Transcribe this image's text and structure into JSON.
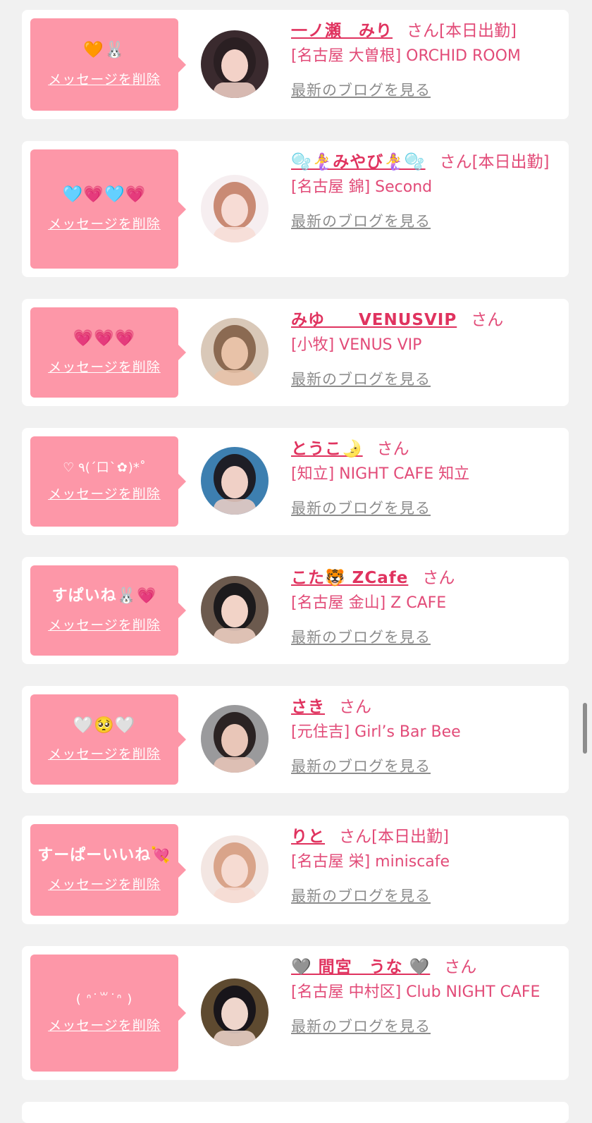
{
  "items": [
    {
      "bubble": "🧡🐰",
      "delete_label": "メッセージを削除",
      "name": "一ノ瀬　みり",
      "san": "さん",
      "status": "[本日出勤]",
      "shop": "[名古屋 大曽根] ORCHID ROOM",
      "blog": "最新のブログを見る",
      "avatar": {
        "bg": "#3a2a2e",
        "skin": "#f3d2c8",
        "hair": "#2a1f22"
      }
    },
    {
      "bubble": "🩵💗🩵💗",
      "delete_label": "メッセージを削除",
      "name": "🫧🧜‍♀️みやび🧜‍♀️🫧",
      "san": "さん",
      "status": "[本日出勤]",
      "shop": "[名古屋 錦] Second",
      "blog": "最新のブログを見る",
      "avatar": {
        "bg": "#f6eef0",
        "skin": "#f7dcd5",
        "hair": "#c98a74"
      }
    },
    {
      "bubble": "💗💗💗",
      "delete_label": "メッセージを削除",
      "name": "みゆ　　VENUSVIP",
      "san": "さん",
      "status": "",
      "shop": "[小牧] VENUS VIP",
      "blog": "最新のブログを見る",
      "avatar": {
        "bg": "#d9c8b8",
        "skin": "#e8c2a8",
        "hair": "#8b6a52"
      }
    },
    {
      "bubble": "♡ ٩(ˊ口ˋ✿)*˚",
      "delete_label": "メッセージを削除",
      "name": "とうこ🌛",
      "san": "さん",
      "status": "",
      "shop": "[知立] NIGHT CAFE 知立",
      "blog": "最新のブログを見る",
      "avatar": {
        "bg": "#3d7fb0",
        "skin": "#f0d0c6",
        "hair": "#1e1e26"
      }
    },
    {
      "bubble": "すぱいね🐰💗",
      "delete_label": "メッセージを削除",
      "name": "こた🐯 ZCafe",
      "san": "さん",
      "status": "",
      "shop": "[名古屋 金山] Z CAFE",
      "blog": "最新のブログを見る",
      "avatar": {
        "bg": "#6c5a4e",
        "skin": "#f2d3c7",
        "hair": "#1c1a1c"
      }
    },
    {
      "bubble": "🤍🥺🤍",
      "delete_label": "メッセージを削除",
      "name": "さき",
      "san": "さん",
      "status": "",
      "shop": "[元住吉] Girl’s Bar Bee",
      "blog": "最新のブログを見る",
      "avatar": {
        "bg": "#9a9a9c",
        "skin": "#e9c6b8",
        "hair": "#2b2323"
      }
    },
    {
      "bubble": "すーぱーいいね💘",
      "delete_label": "メッセージを削除",
      "name": "りと",
      "san": "さん",
      "status": "[本日出勤]",
      "shop": "[名古屋 栄] miniscafe",
      "blog": "最新のブログを見る",
      "avatar": {
        "bg": "#f3e6e2",
        "skin": "#f6dbd2",
        "hair": "#d9a48a"
      }
    },
    {
      "bubble": "( ᐢ˙꒳˙ᐢ )",
      "delete_label": "メッセージを削除",
      "name": "🩶 間宮　うな 🩶",
      "san": "さん",
      "status": "",
      "shop": "[名古屋 中村区] Club NIGHT CAFE",
      "blog": "最新のブログを見る",
      "avatar": {
        "bg": "#5e4a30",
        "skin": "#efd6cc",
        "hair": "#18151a"
      }
    }
  ],
  "colors": {
    "bubble": "#fd97a8",
    "name": "#e0335f",
    "shop": "#e24b78",
    "blog": "#8c8c8c",
    "page_bg": "#f1f1f1"
  }
}
